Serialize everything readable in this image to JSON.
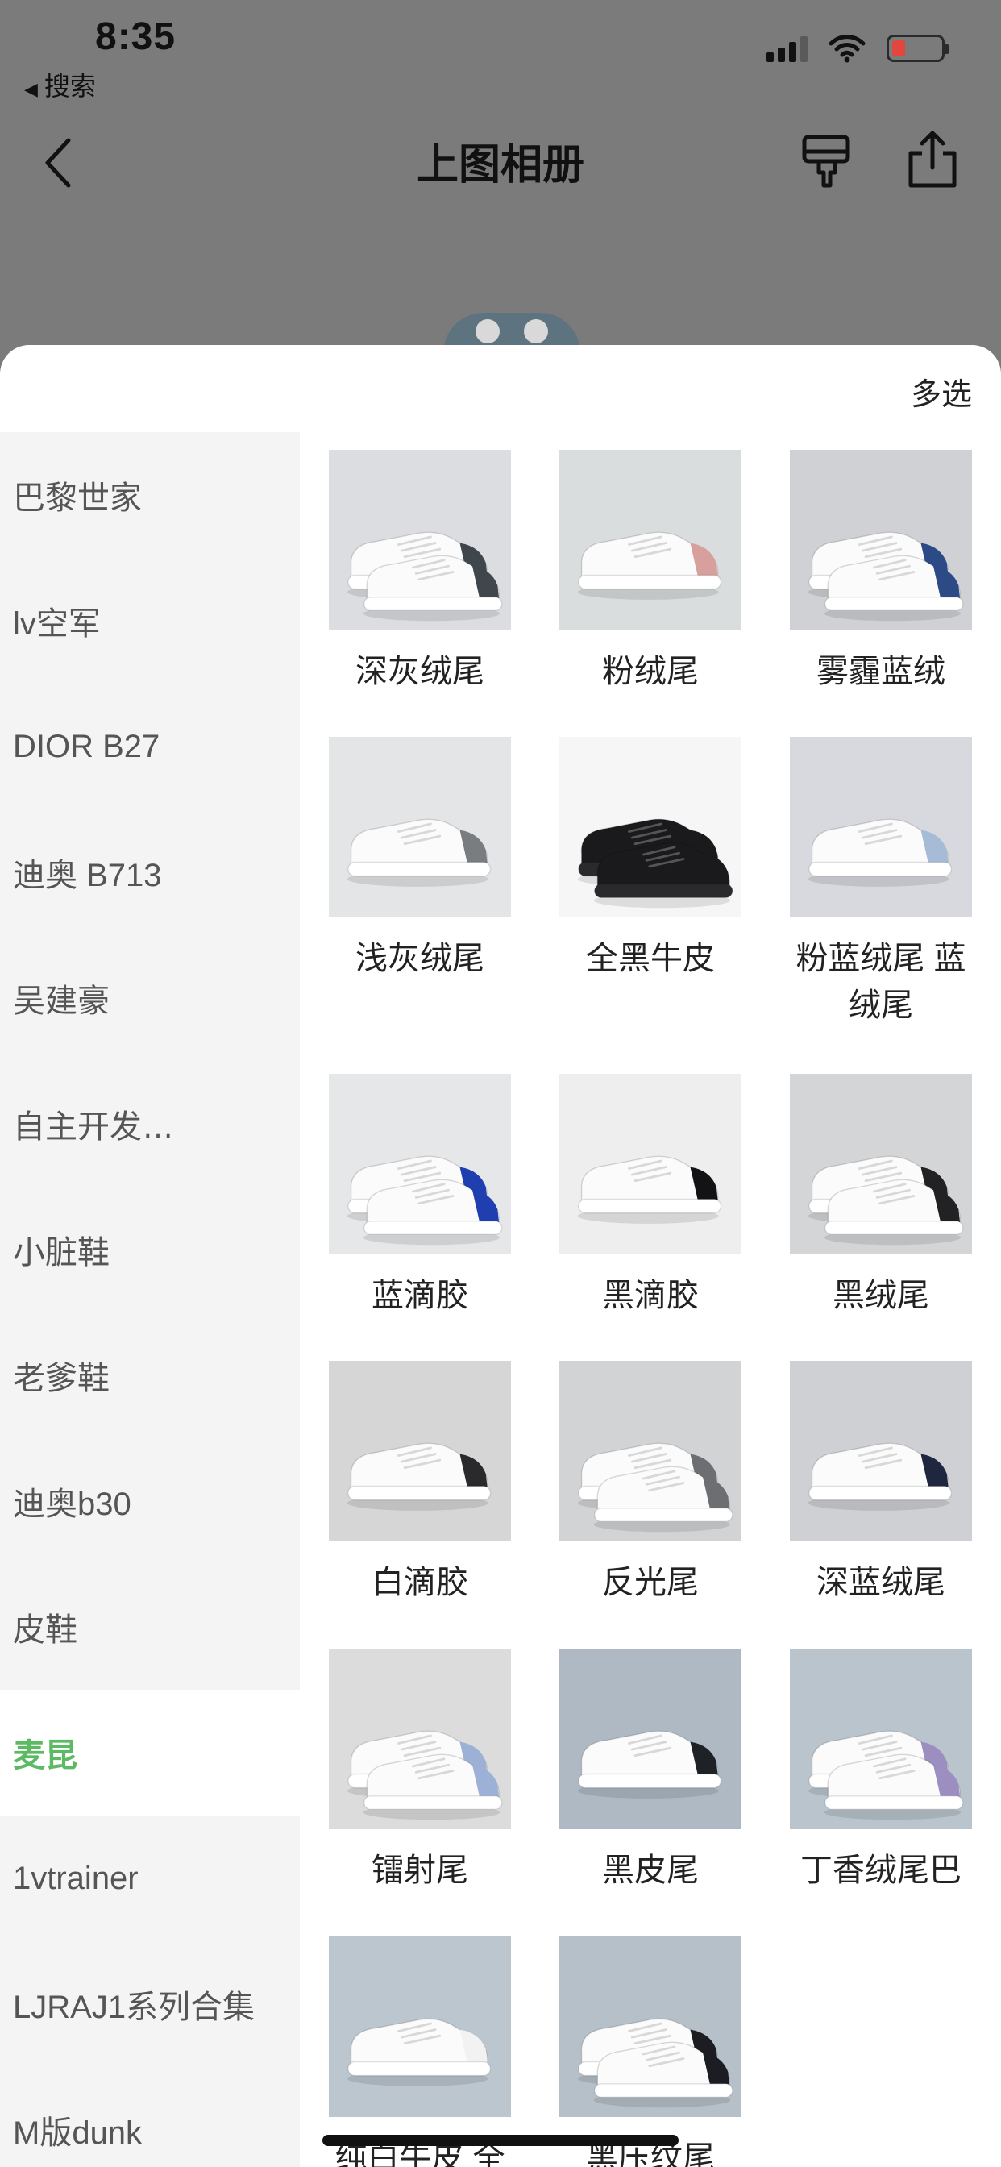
{
  "status_bar": {
    "time": "8:35",
    "back_app_label": "搜索",
    "battery_color": "#e2473f"
  },
  "nav": {
    "title": "上图相册",
    "icons": [
      "back-chevron-icon",
      "brush-icon",
      "share-icon"
    ]
  },
  "sheet": {
    "multiselect_label": "多选",
    "accent_color": "#5cba64"
  },
  "sidebar": {
    "items": [
      {
        "label": "巴黎世家"
      },
      {
        "label": "lv空军"
      },
      {
        "label": "DIOR B27"
      },
      {
        "label": "迪奥 B713"
      },
      {
        "label": "吴建豪"
      },
      {
        "label": "自主开发…"
      },
      {
        "label": "小脏鞋"
      },
      {
        "label": "老爹鞋"
      },
      {
        "label": "迪奥b30"
      },
      {
        "label": "皮鞋"
      },
      {
        "label": "麦昆",
        "active": true
      },
      {
        "label": "1vtrainer"
      },
      {
        "label": "LJRAJ1系列合集"
      },
      {
        "label": "M版dunk"
      }
    ]
  },
  "albums": [
    {
      "title": "深灰绒尾",
      "bg": "#dcdde0",
      "accent": "#3f474d"
    },
    {
      "title": "粉绒尾",
      "bg": "#d9dddd",
      "accent": "#d7a09c"
    },
    {
      "title": "雾霾蓝绒",
      "bg": "#cfd1d4",
      "accent": "#2b4a86"
    },
    {
      "title": "浅灰绒尾",
      "bg": "#e4e5e7",
      "accent": "#7a7d80"
    },
    {
      "title": "全黑牛皮",
      "bg": "#f6f6f6",
      "accent": "#1a1a1c"
    },
    {
      "title": "粉蓝绒尾 蓝绒尾",
      "bg": "#d7d9de",
      "accent": "#a6bbd6"
    },
    {
      "title": "蓝滴胶",
      "bg": "#e6e7e8",
      "accent": "#1f3fb0"
    },
    {
      "title": "黑滴胶",
      "bg": "#eeeeee",
      "accent": "#131316"
    },
    {
      "title": "黑绒尾",
      "bg": "#d4d5d6",
      "accent": "#222224"
    },
    {
      "title": "白滴胶",
      "bg": "#d6d6d7",
      "accent": "#2a2a2c"
    },
    {
      "title": "反光尾",
      "bg": "#d2d3d5",
      "accent": "#6c6e72"
    },
    {
      "title": "深蓝绒尾",
      "bg": "#cfd0d3",
      "accent": "#1f2740"
    },
    {
      "title": "镭射尾",
      "bg": "#dcdcdd",
      "accent": "#9db0d6"
    },
    {
      "title": "黑皮尾",
      "bg": "#aeb9c4",
      "accent": "#1e2126"
    },
    {
      "title": "丁香绒尾巴",
      "bg": "#b9c4cd",
      "accent": "#9c8ec0"
    },
    {
      "title": "纯白牛皮 全",
      "bg": "#bcc6ce",
      "accent": "#f2f2f2"
    },
    {
      "title": "黑压纹尾",
      "bg": "#b6c0c8",
      "accent": "#1b1d22"
    }
  ]
}
